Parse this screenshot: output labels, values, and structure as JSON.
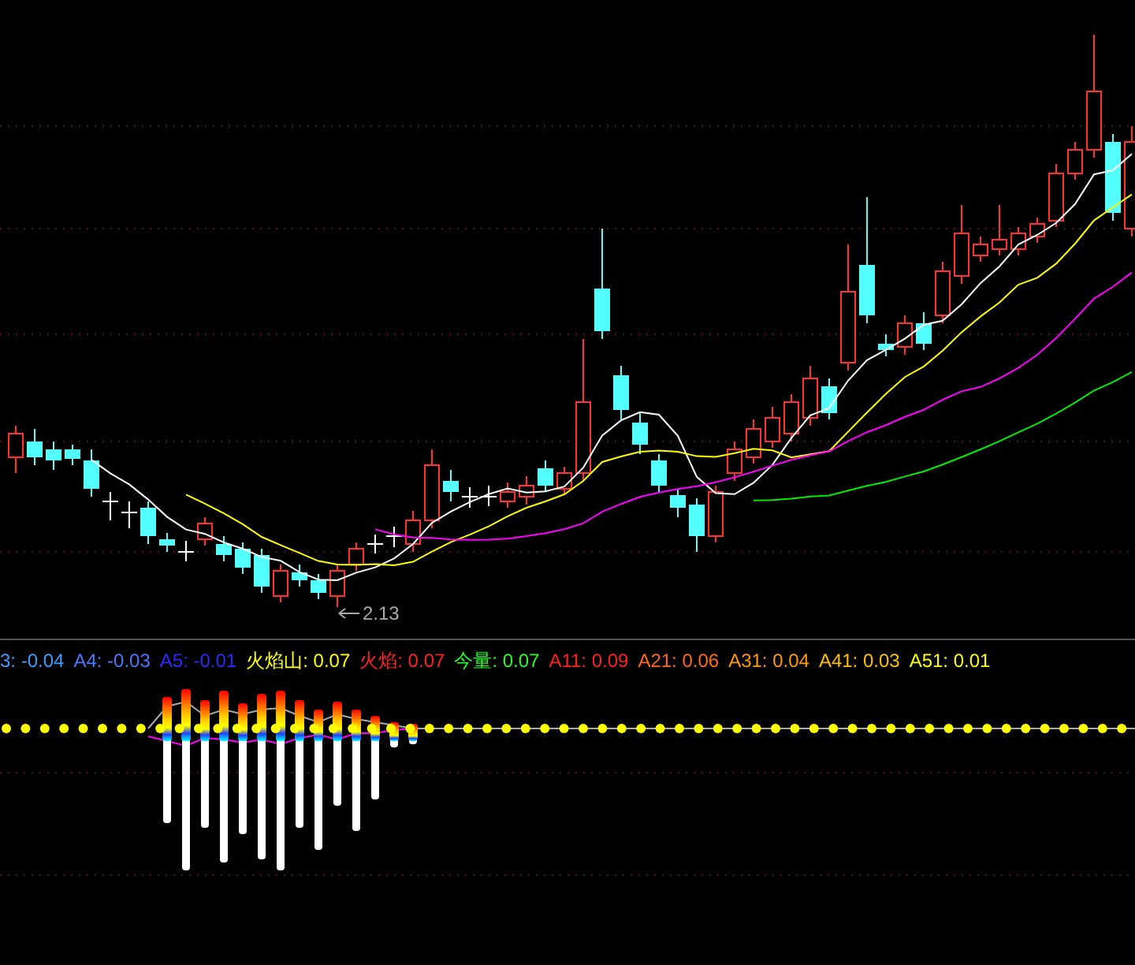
{
  "price_chart": {
    "low_label": "2.13"
  },
  "indicator_legend": [
    {
      "text": "3: -0.04",
      "color": "#3c9cff"
    },
    {
      "text": "A4: -0.03",
      "color": "#4a78ff"
    },
    {
      "text": "A5: -0.01",
      "color": "#2a2aff"
    },
    {
      "text": "火焰山: 0.07",
      "color": "#ffff00"
    },
    {
      "text": "火焰: 0.07",
      "color": "#ff2020"
    },
    {
      "text": "今量: 0.07",
      "color": "#20ff20"
    },
    {
      "text": "A11: 0.09",
      "color": "#ff2020"
    },
    {
      "text": "A21: 0.06",
      "color": "#ff6a10"
    },
    {
      "text": "A31: 0.04",
      "color": "#ff9a00"
    },
    {
      "text": "A41: 0.03",
      "color": "#ffc000"
    },
    {
      "text": "A51: 0.01",
      "color": "#ffff00"
    }
  ]
}
